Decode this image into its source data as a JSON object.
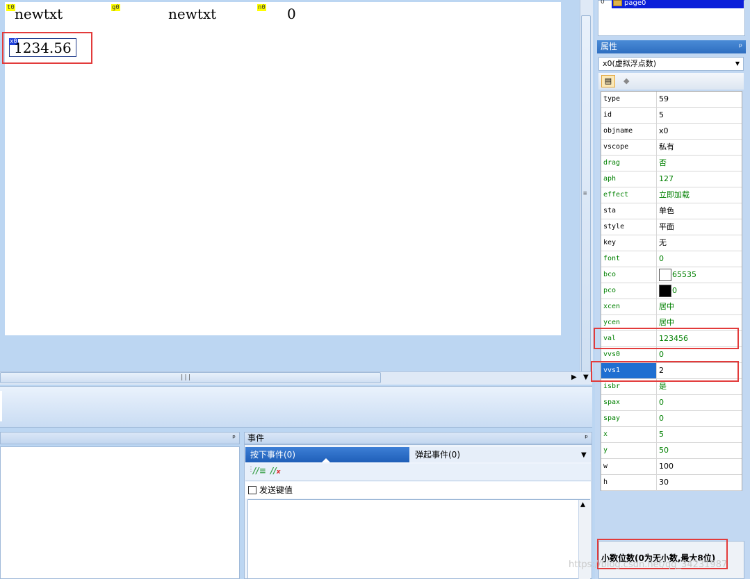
{
  "canvas": {
    "components": [
      {
        "tag": "t0",
        "text": "newtxt"
      },
      {
        "tag": "g0",
        "text": "newtxt"
      },
      {
        "tag": "n0",
        "text": "0"
      }
    ],
    "selected": {
      "tag": "x0",
      "text": "1234.56"
    }
  },
  "tree": {
    "selected_item": "page0",
    "expander": "0"
  },
  "properties": {
    "title": "属性",
    "pin": "ᵖ",
    "object_select": "x0(虚拟浮点数)",
    "rows": [
      {
        "name": "type",
        "value": "59",
        "color": "#000000"
      },
      {
        "name": "id",
        "value": "5",
        "color": "#000000"
      },
      {
        "name": "objname",
        "value": "x0",
        "color": "#000000"
      },
      {
        "name": "vscope",
        "value": "私有",
        "color": "#000000"
      },
      {
        "name": "drag",
        "value": "否",
        "color": "#008000"
      },
      {
        "name": "aph",
        "value": "127",
        "color": "#008000"
      },
      {
        "name": "effect",
        "value": "立即加载",
        "color": "#008000"
      },
      {
        "name": "sta",
        "value": "单色",
        "color": "#000000"
      },
      {
        "name": "style",
        "value": "平面",
        "color": "#000000"
      },
      {
        "name": "key",
        "value": "无",
        "color": "#000000"
      },
      {
        "name": "font",
        "value": "0",
        "color": "#008000"
      },
      {
        "name": "bco",
        "value": "65535",
        "color": "#008000",
        "swatch": "#ffffff"
      },
      {
        "name": "pco",
        "value": "0",
        "color": "#008000",
        "swatch": "#000000"
      },
      {
        "name": "xcen",
        "value": "居中",
        "color": "#008000"
      },
      {
        "name": "ycen",
        "value": "居中",
        "color": "#008000"
      },
      {
        "name": "val",
        "value": "123456",
        "color": "#008000"
      },
      {
        "name": "vvs0",
        "value": "0",
        "color": "#008000"
      },
      {
        "name": "vvs1",
        "value": "2",
        "color": "#000000",
        "selected": true
      },
      {
        "name": "isbr",
        "value": "是",
        "color": "#008000"
      },
      {
        "name": "spax",
        "value": "0",
        "color": "#008000"
      },
      {
        "name": "spay",
        "value": "0",
        "color": "#008000"
      },
      {
        "name": "x",
        "value": "5",
        "color": "#008000"
      },
      {
        "name": "y",
        "value": "50",
        "color": "#008000"
      },
      {
        "name": "w",
        "value": "100",
        "color": "#000000"
      },
      {
        "name": "h",
        "value": "30",
        "color": "#000000"
      }
    ],
    "description": "小数位数(0为无小数,最大8位)"
  },
  "events": {
    "title": "事件",
    "pin": "ᵖ",
    "tab_press": "按下事件(0)",
    "tab_release": "弹起事件(0)",
    "send_key_label": "发送键值"
  },
  "left_panel": {
    "pin": "ᵖ"
  },
  "watermark": "https://blog.csdn.net/qq_34231987"
}
